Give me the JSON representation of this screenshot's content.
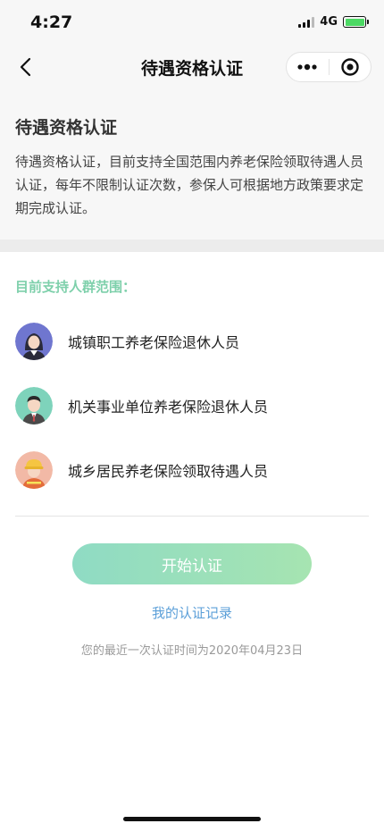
{
  "status_bar": {
    "time": "4:27",
    "network": "4G",
    "battery_level": 1.0,
    "battery_color": "#4cd964"
  },
  "nav": {
    "title": "待遇资格认证",
    "back_icon": "chevron-left-icon",
    "more_icon": "more-dots-icon",
    "close_icon": "target-icon"
  },
  "intro": {
    "title": "待遇资格认证",
    "description": "待遇资格认证，目前支持全国范围内养老保险领取待遇人员认证，每年不限制认证次数，参保人可根据地方政策要求定期完成认证。"
  },
  "scope": {
    "label": "目前支持人群范围：",
    "items": [
      {
        "label": "城镇职工养老保险退休人员",
        "icon": "female-worker-avatar-icon",
        "color": "#6f76cf"
      },
      {
        "label": "机关事业单位养老保险退休人员",
        "icon": "male-official-avatar-icon",
        "color": "#7ed3bb"
      },
      {
        "label": "城乡居民养老保险领取待遇人员",
        "icon": "construction-worker-avatar-icon",
        "color": "#f2b9a6"
      }
    ]
  },
  "actions": {
    "start_button": "开始认证",
    "record_link": "我的认证记录",
    "last_time_text": "您的最近一次认证时间为2020年04月23日"
  },
  "colors": {
    "accent_green": "#7ed0ab",
    "link_blue": "#5b9fd8",
    "button_gradient_start": "#8fdbc4",
    "button_gradient_end": "#a6e4b1"
  }
}
